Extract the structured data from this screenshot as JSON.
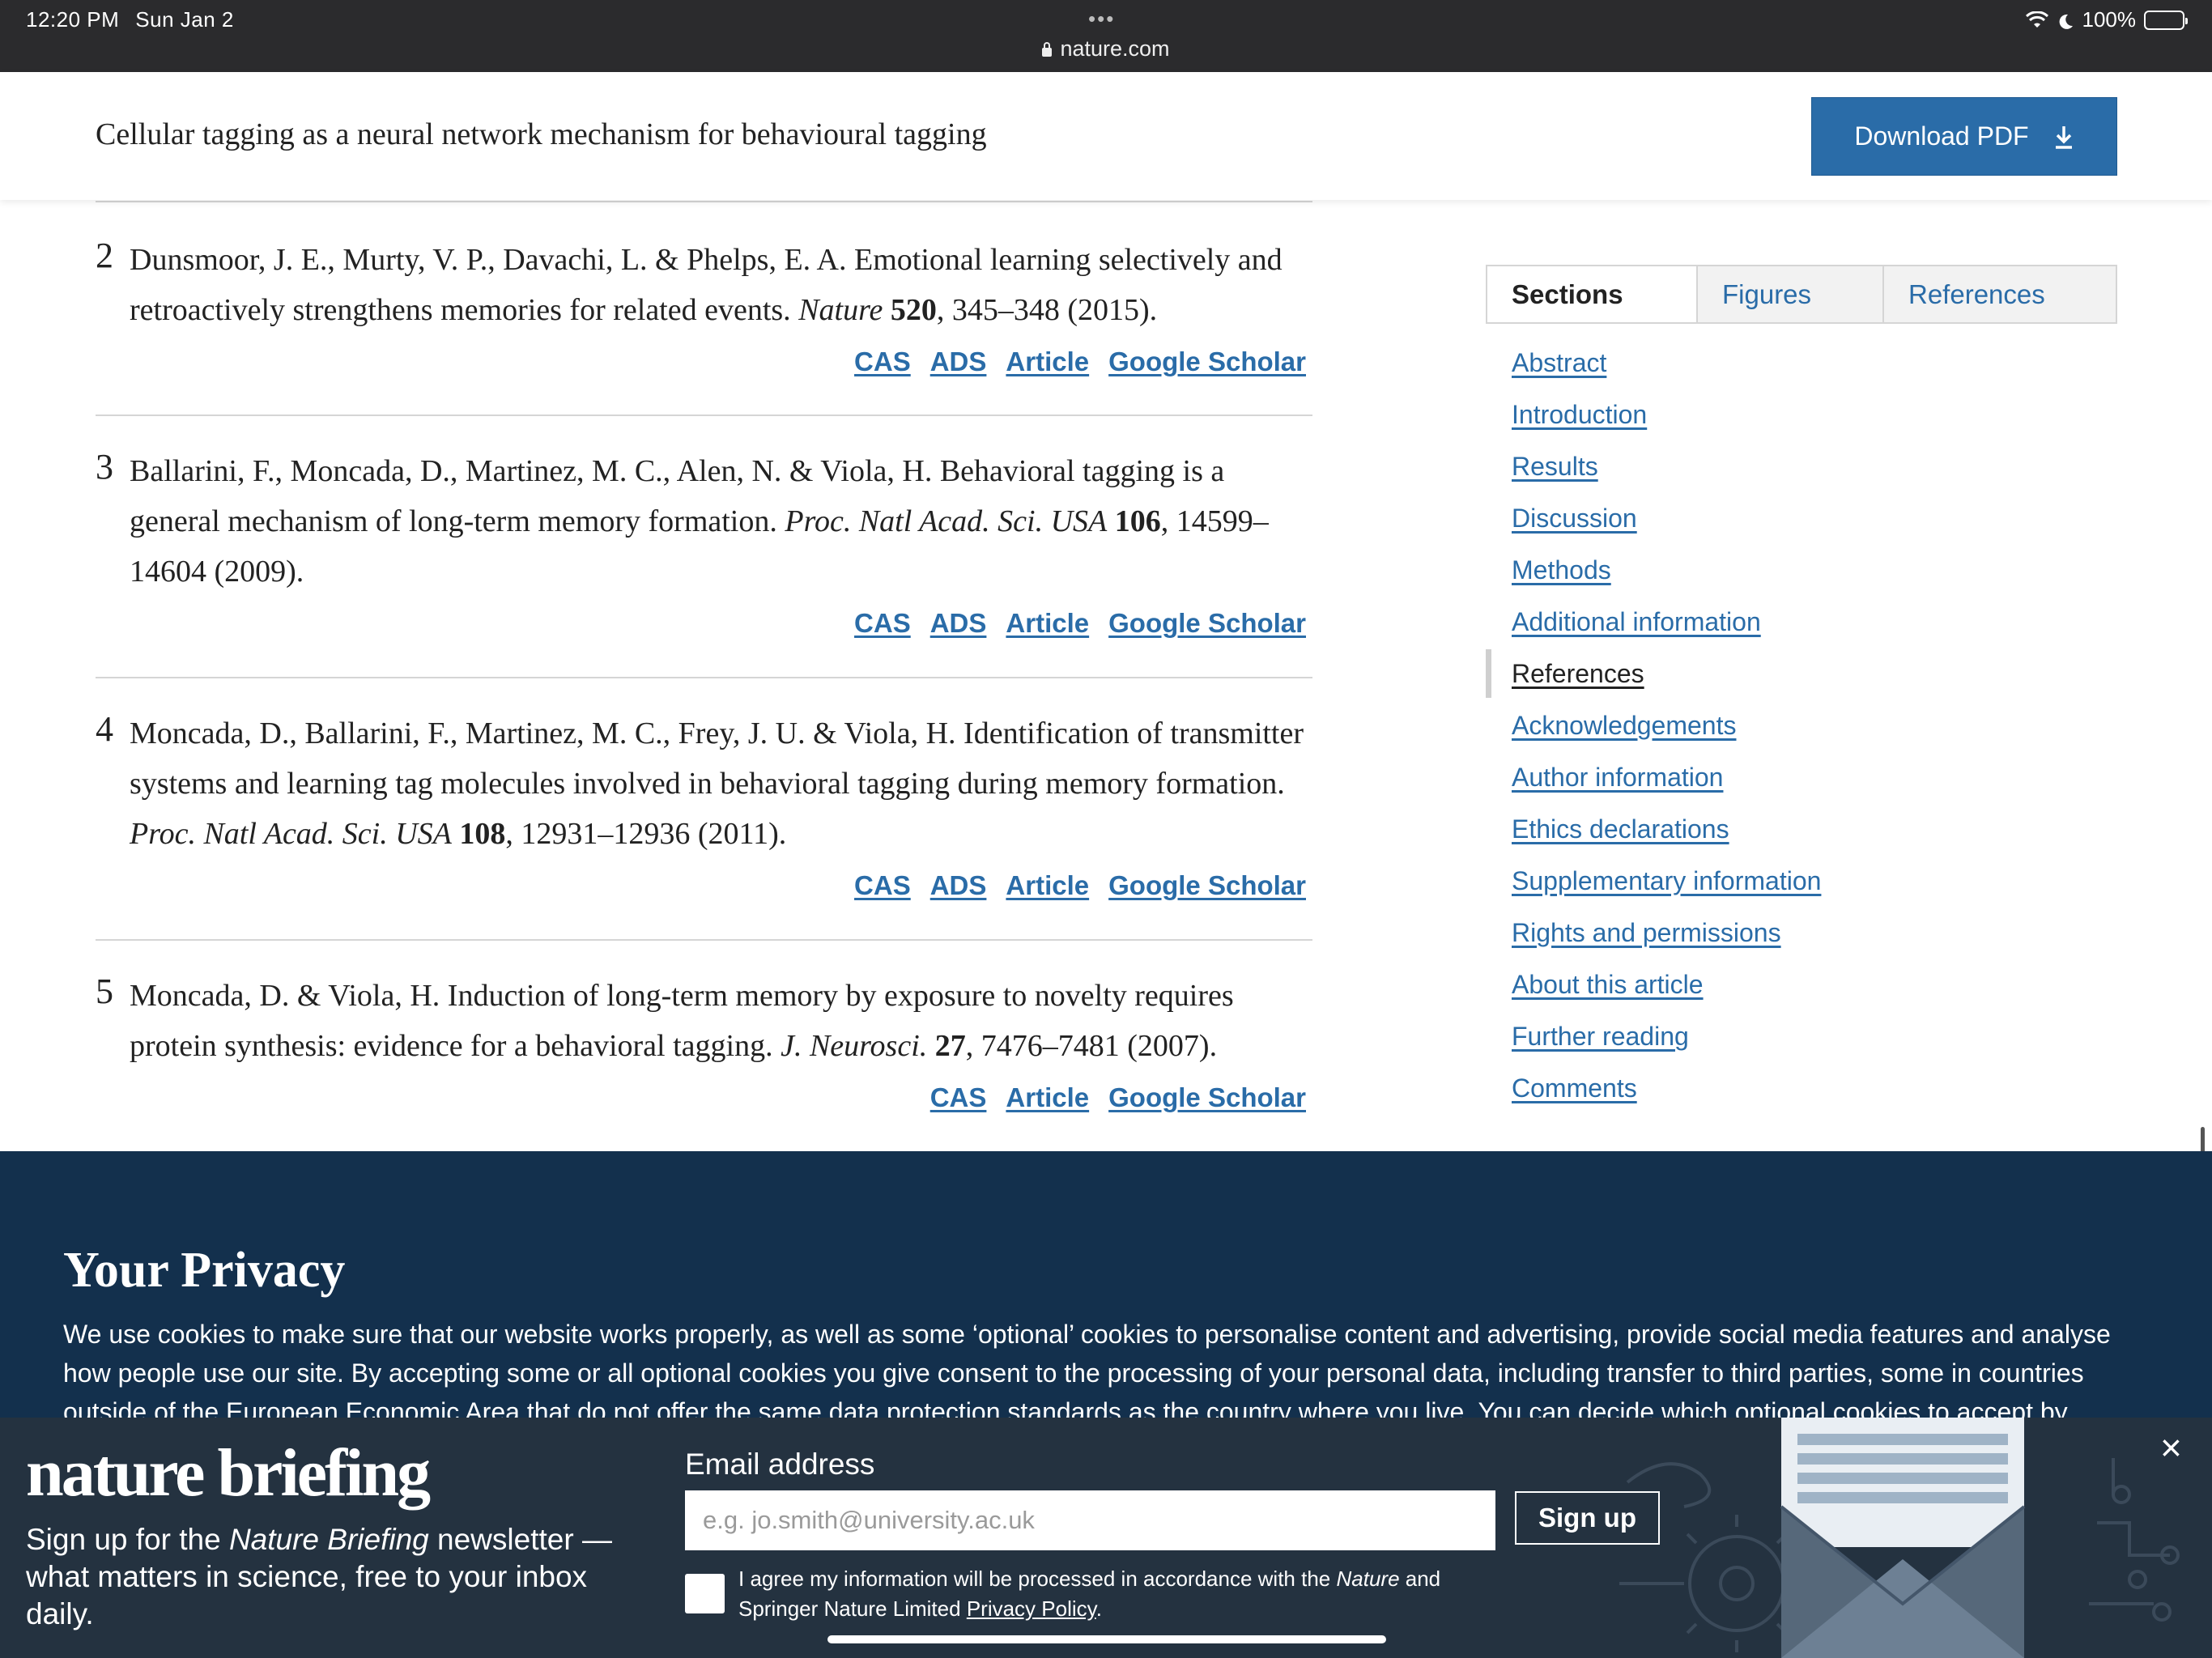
{
  "status_bar": {
    "time": "12:20 PM",
    "date": "Sun Jan 2",
    "url": "nature.com",
    "battery": "100%",
    "battery_level": 1.0
  },
  "header": {
    "title": "Cellular tagging as a neural network mechanism for behavioural tagging",
    "download_label": "Download PDF"
  },
  "references": [
    {
      "num": "2",
      "authors": "Dunsmoor, J. E., Murty, V. P., Davachi, L. & Phelps, E. A. Emotional learning selectively and retroactively strengthens memories for related events. ",
      "journal": "Nature",
      "volume": "520",
      "pages": ", 345–348 (2015).",
      "links": [
        "CAS",
        "ADS",
        "Article",
        "Google Scholar"
      ]
    },
    {
      "num": "3",
      "authors": "Ballarini, F., Moncada, D., Martinez, M. C., Alen, N. & Viola, H. Behavioral tagging is a general mechanism of long-term memory formation. ",
      "journal": "Proc. Natl Acad. Sci. USA",
      "volume": "106",
      "pages": ", 14599–14604 (2009).",
      "links": [
        "CAS",
        "ADS",
        "Article",
        "Google Scholar"
      ]
    },
    {
      "num": "4",
      "authors": "Moncada, D., Ballarini, F., Martinez, M. C., Frey, J. U. & Viola, H. Identification of transmitter systems and learning tag molecules involved in behavioral tagging during memory formation. ",
      "journal": "Proc. Natl Acad. Sci. USA",
      "volume": "108",
      "pages": ", 12931–12936 (2011).",
      "links": [
        "CAS",
        "ADS",
        "Article",
        "Google Scholar"
      ]
    },
    {
      "num": "5",
      "authors": "Moncada, D. & Viola, H. Induction of long-term memory by exposure to novelty requires protein synthesis: evidence for a behavioral tagging. ",
      "journal": "J. Neurosci.",
      "volume": "27",
      "pages": ", 7476–7481 (2007).",
      "links": [
        "CAS",
        "Article",
        "Google Scholar"
      ]
    }
  ],
  "sidebar": {
    "tabs": [
      "Sections",
      "Figures",
      "References"
    ],
    "sections": [
      "Abstract",
      "Introduction",
      "Results",
      "Discussion",
      "Methods",
      "Additional information",
      "References",
      "Acknowledgements",
      "Author information",
      "Ethics declarations",
      "Supplementary information",
      "Rights and permissions",
      "About this article",
      "Further reading",
      "Comments"
    ],
    "current_section": "References"
  },
  "privacy": {
    "title": "Your Privacy",
    "text": "We use cookies to make sure that our website works properly, as well as some ‘optional’ cookies to personalise content and advertising, provide social media features and analyse how people use our site. By accepting some or all optional cookies you give consent to the processing of your personal data, including transfer to third parties, some in countries outside of the European Economic Area that do not offer the same data protection standards as the country where you live. You can decide which optional cookies to accept by"
  },
  "briefing": {
    "brand": "nature briefing",
    "desc_prefix": "Sign up for the ",
    "desc_em": "Nature Briefing",
    "desc_suffix": " newsletter — what matters in science, free to your inbox daily.",
    "email_label": "Email address",
    "email_placeholder": "e.g. jo.smith@university.ac.uk",
    "signup_label": "Sign up",
    "agree_prefix": "I agree my information will be processed in accordance with the ",
    "agree_em": "Nature",
    "agree_mid": " and Springer Nature Limited ",
    "agree_link": "Privacy Policy",
    "agree_end": ".",
    "close": "×"
  },
  "colors": {
    "link": "#2a6ca8",
    "privacy_bg": "#13304d",
    "briefing_bg": "#243240",
    "statusbar_bg": "#2b2b2d"
  },
  "icons": [
    "lock-icon",
    "wifi-icon",
    "moon-icon",
    "battery-icon",
    "download-icon",
    "close-icon",
    "envelope-illustration"
  ]
}
